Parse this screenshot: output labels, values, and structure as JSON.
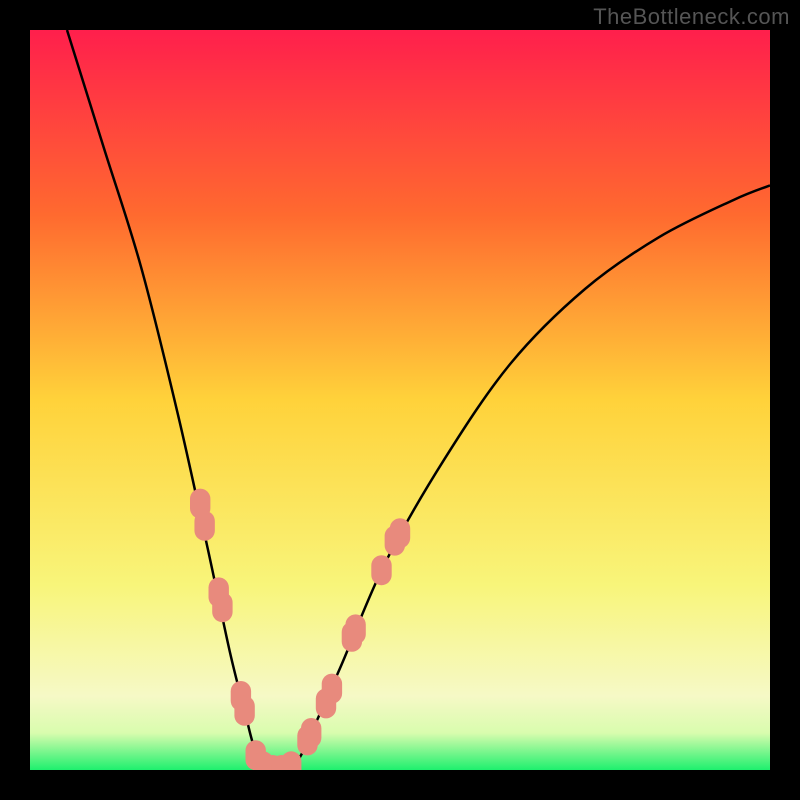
{
  "watermark": "TheBottleneck.com",
  "chart_data": {
    "type": "line",
    "title": "",
    "xlabel": "",
    "ylabel": "",
    "xlim": [
      0,
      100
    ],
    "ylim": [
      0,
      100
    ],
    "gradient_stops": [
      {
        "offset": 0.0,
        "color": "#ff1f4c"
      },
      {
        "offset": 0.25,
        "color": "#ff6a2f"
      },
      {
        "offset": 0.5,
        "color": "#ffd23a"
      },
      {
        "offset": 0.75,
        "color": "#f8f57a"
      },
      {
        "offset": 0.9,
        "color": "#f6f9c6"
      },
      {
        "offset": 0.95,
        "color": "#d9fcae"
      },
      {
        "offset": 1.0,
        "color": "#1ef06e"
      }
    ],
    "series": [
      {
        "name": "bottleneck-curve",
        "color": "#000000",
        "points": [
          {
            "x": 5,
            "y": 100
          },
          {
            "x": 10,
            "y": 84
          },
          {
            "x": 15,
            "y": 68
          },
          {
            "x": 20,
            "y": 48
          },
          {
            "x": 24,
            "y": 30
          },
          {
            "x": 27,
            "y": 16
          },
          {
            "x": 29,
            "y": 8
          },
          {
            "x": 30,
            "y": 4
          },
          {
            "x": 31,
            "y": 1
          },
          {
            "x": 32,
            "y": 0
          },
          {
            "x": 34,
            "y": 0
          },
          {
            "x": 36,
            "y": 1
          },
          {
            "x": 38,
            "y": 5
          },
          {
            "x": 42,
            "y": 14
          },
          {
            "x": 48,
            "y": 28
          },
          {
            "x": 56,
            "y": 42
          },
          {
            "x": 65,
            "y": 55
          },
          {
            "x": 75,
            "y": 65
          },
          {
            "x": 85,
            "y": 72
          },
          {
            "x": 95,
            "y": 77
          },
          {
            "x": 100,
            "y": 79
          }
        ]
      }
    ],
    "markers": {
      "name": "highlight-range",
      "color": "#e88a7d",
      "radius": 12,
      "points": [
        {
          "x": 23.0,
          "y": 36
        },
        {
          "x": 23.6,
          "y": 33
        },
        {
          "x": 25.5,
          "y": 24
        },
        {
          "x": 26.0,
          "y": 22
        },
        {
          "x": 28.5,
          "y": 10
        },
        {
          "x": 29.0,
          "y": 8
        },
        {
          "x": 30.5,
          "y": 2
        },
        {
          "x": 31.5,
          "y": 0.5
        },
        {
          "x": 32.8,
          "y": 0
        },
        {
          "x": 34.0,
          "y": 0
        },
        {
          "x": 35.3,
          "y": 0.5
        },
        {
          "x": 37.5,
          "y": 4
        },
        {
          "x": 38.0,
          "y": 5
        },
        {
          "x": 40.0,
          "y": 9
        },
        {
          "x": 40.8,
          "y": 11
        },
        {
          "x": 43.5,
          "y": 18
        },
        {
          "x": 44.0,
          "y": 19
        },
        {
          "x": 47.5,
          "y": 27
        },
        {
          "x": 49.3,
          "y": 31
        },
        {
          "x": 50.0,
          "y": 32
        }
      ]
    }
  }
}
